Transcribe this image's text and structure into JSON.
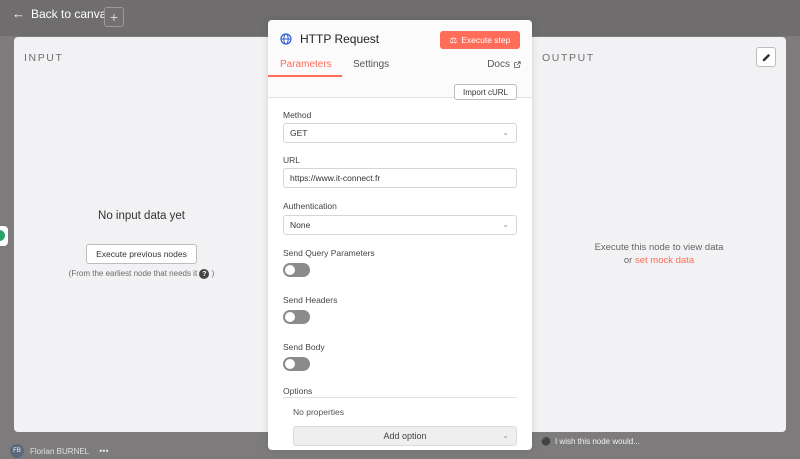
{
  "topbar": {
    "back_label": "Back to canvas",
    "plus_label": "+"
  },
  "input": {
    "title": "INPUT",
    "empty_title": "No input data yet",
    "exec_prev_label": "Execute previous nodes",
    "earliest_note": "(From the earliest node that needs it",
    "earliest_note_end": ")",
    "help_icon": "?"
  },
  "output": {
    "title": "OUTPUT",
    "msg_line1": "Execute this node to view data",
    "msg_or": "or",
    "mock_link": "set mock data"
  },
  "node": {
    "title": "HTTP Request",
    "execute_label": "Execute step",
    "tabs": [
      {
        "label": "Parameters",
        "active": true
      },
      {
        "label": "Settings",
        "active": false
      }
    ],
    "docs_label": "Docs",
    "import_curl": "Import cURL",
    "method": {
      "label": "Method",
      "value": "GET"
    },
    "url": {
      "label": "URL",
      "value": "https://www.it-connect.fr"
    },
    "auth": {
      "label": "Authentication",
      "value": "None"
    },
    "toggles": [
      {
        "label": "Send Query Parameters",
        "on": false
      },
      {
        "label": "Send Headers",
        "on": false
      },
      {
        "label": "Send Body",
        "on": false
      }
    ],
    "options_label": "Options",
    "no_properties": "No properties",
    "add_option": "Add option"
  },
  "bottom": {
    "wish": "I wish this node would...",
    "user_name": "Florian BURNEL",
    "user_initials": "FB",
    "more": "•••"
  },
  "colors": {
    "accent": "#ff6d5a",
    "panel_bg": "#f2f1f3"
  }
}
